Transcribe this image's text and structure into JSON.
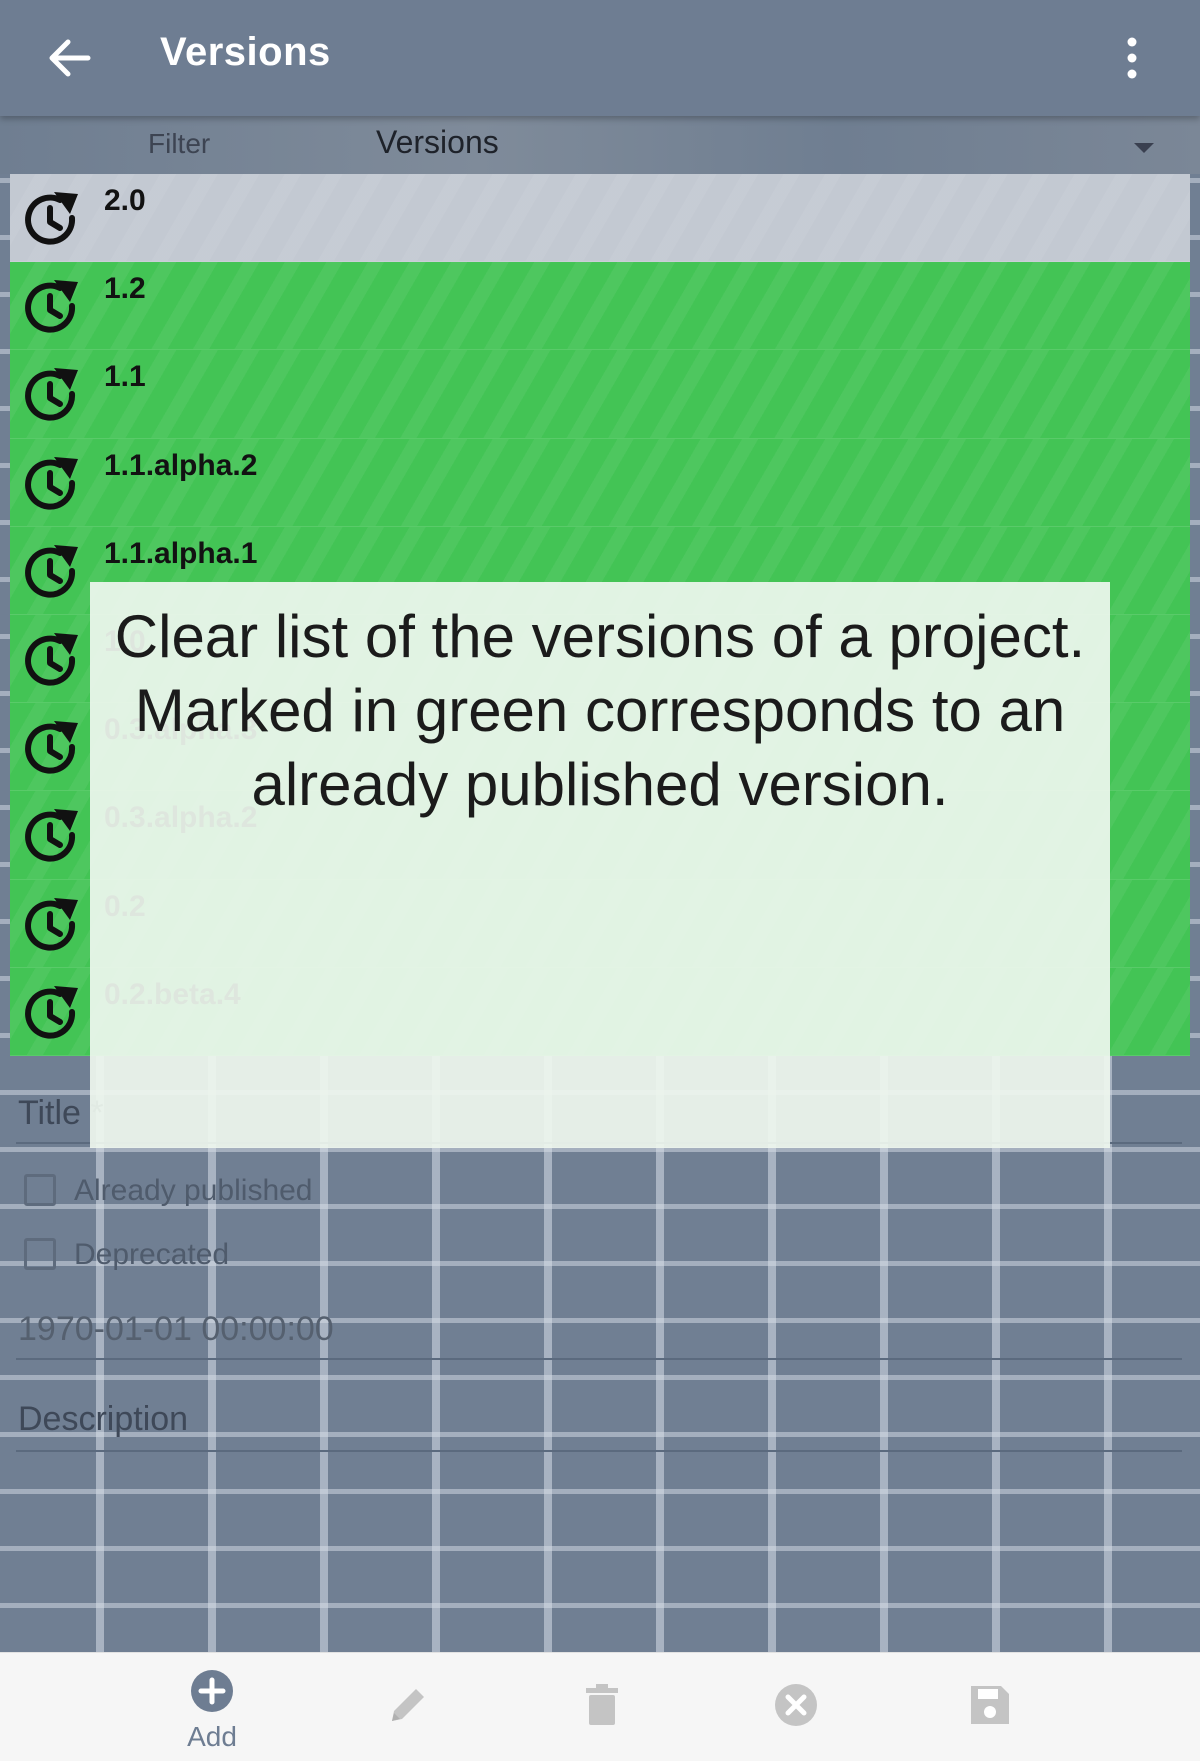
{
  "toolbar": {
    "title": "Versions",
    "back_icon": "arrow-left-icon",
    "menu_icon": "more-vert-icon"
  },
  "filter": {
    "label": "Filter",
    "selected": "Versions"
  },
  "versions": [
    {
      "label": "2.0",
      "published": false,
      "selected": true
    },
    {
      "label": "1.2",
      "published": true
    },
    {
      "label": "1.1",
      "published": true
    },
    {
      "label": "1.1.alpha.2",
      "published": true
    },
    {
      "label": "1.1.alpha.1",
      "published": true
    },
    {
      "label": "1.0",
      "published": true
    },
    {
      "label": "0.3.alpha.3",
      "published": true
    },
    {
      "label": "0.3.alpha.2",
      "published": true
    },
    {
      "label": "0.2",
      "published": true
    },
    {
      "label": "0.2.beta.4",
      "published": true
    }
  ],
  "form": {
    "title_placeholder": "Title *",
    "already_published_label": "Already published",
    "deprecated_label": "Deprecated",
    "date_value": "1970-01-01 00:00:00",
    "description_placeholder": "Description"
  },
  "tooltip": {
    "line1": "Clear list of the versions of a project.",
    "line2": "Marked in green corresponds to an already published version."
  },
  "bottom_bar": {
    "add_label": "Add",
    "icons": [
      "add-circle-icon",
      "edit-pencil-icon",
      "delete-trash-icon",
      "cancel-icon",
      "save-disk-icon"
    ]
  },
  "colors": {
    "published_green": "#43c455",
    "selected_row": "#c3c9d2",
    "toolbar": "#6e7d92"
  }
}
